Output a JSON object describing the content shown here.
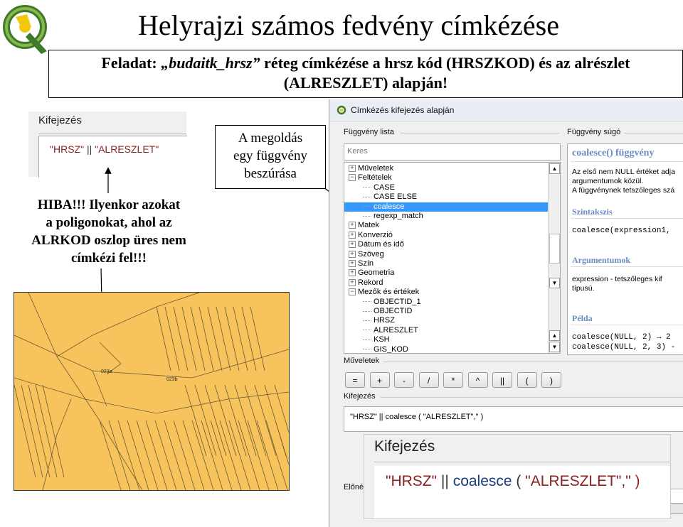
{
  "title": "Helyrajzi számos fedvény címkézése",
  "task": {
    "prefix": "Feladat: ",
    "layer": "„budaitk_hrsz”",
    "line1_rest": " réteg címkézése a hrsz kód (HRSZKOD) és az alrészlet",
    "line2": "(ALRESZLET) alapján!"
  },
  "left_expression": {
    "label": "Kifejezés",
    "code_str1": "\"HRSZ\"",
    "code_op": "||",
    "code_str2": "\"ALRESZLET\""
  },
  "error_text": {
    "line1": "HIBA!!! Ilyenkor azokat",
    "line2": "a poligonokat, ahol  az",
    "line3": "ALRKOD oszlop üres nem",
    "line4": "címkézi fel!!!"
  },
  "callout": {
    "line1": "A megoldás",
    "line2": "egy függvény",
    "line3": "beszúrása"
  },
  "map": {
    "fill_color": "#f7c35c",
    "label_a": "023a",
    "label_b": "023b"
  },
  "dialog": {
    "title": "Címkézés kifejezés alapján",
    "function_list_label": "Függvény lista",
    "function_help_label": "Függvény súgó",
    "search_placeholder": "Keres",
    "tree": [
      {
        "label": "Műveletek",
        "expander": "+",
        "level": 0
      },
      {
        "label": "Feltételek",
        "expander": "−",
        "level": 0
      },
      {
        "label": "CASE",
        "level": 1
      },
      {
        "label": "CASE ELSE",
        "level": 1
      },
      {
        "label": "coalesce",
        "level": 1,
        "selected": true
      },
      {
        "label": "regexp_match",
        "level": 1
      },
      {
        "label": "Matek",
        "expander": "+",
        "level": 0
      },
      {
        "label": "Konverzió",
        "expander": "+",
        "level": 0
      },
      {
        "label": "Dátum és idő",
        "expander": "+",
        "level": 0
      },
      {
        "label": "Szöveg",
        "expander": "+",
        "level": 0
      },
      {
        "label": "Szín",
        "expander": "+",
        "level": 0
      },
      {
        "label": "Geometria",
        "expander": "+",
        "level": 0
      },
      {
        "label": "Rekord",
        "expander": "+",
        "level": 0
      },
      {
        "label": "Mezők és értékek",
        "expander": "−",
        "level": 0
      },
      {
        "label": "OBJECTID_1",
        "level": 1
      },
      {
        "label": "OBJECTID",
        "level": 1
      },
      {
        "label": "HRSZ",
        "level": 1
      },
      {
        "label": "ALRESZLET",
        "level": 1
      },
      {
        "label": "KSH",
        "level": 1
      },
      {
        "label": "GIS_KOD",
        "level": 1
      }
    ],
    "help": {
      "heading": "coalesce() függvény",
      "desc1": "Az első nem NULL értéket adja",
      "desc2": "argumentumok közül.",
      "desc3": "A függvénynek tetszőleges szá",
      "syntax_h": "Szintakszis",
      "syntax": "coalesce(expression1,",
      "args_h": "Argumentumok",
      "args1": "expression - tetszőleges kif",
      "args2": "típusú.",
      "example_h": "Példa",
      "ex1": "coalesce(NULL, 2) → 2",
      "ex2": "coalesce(NULL, 2, 3) -"
    },
    "operators_label": "Műveletek",
    "operators": [
      "=",
      "+",
      "-",
      "/",
      "*",
      "^",
      "||",
      "(",
      ")"
    ],
    "expression_label": "Kifejezés",
    "expression": "\"HRSZ\" || coalesce ( \"ALRESZLET\",\" )",
    "preview_label": "Előnéz"
  },
  "zoom_expression": {
    "label": "Kifejezés",
    "str1": "\"HRSZ\"",
    "op": "||",
    "fn": "coalesce",
    "paren_open": "(",
    "str2": "\"ALRESZLET\"",
    "rest": ",\" )"
  },
  "colors": {
    "selection": "#3399ff",
    "help_heading": "#6a8bc0",
    "string_color": "#8b2222"
  }
}
